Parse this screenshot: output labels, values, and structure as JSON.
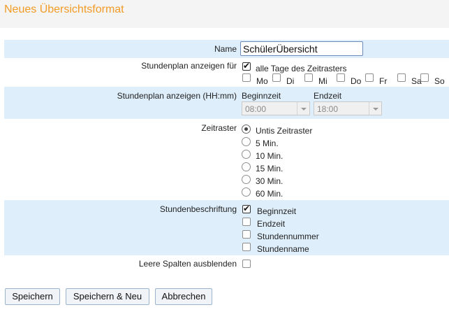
{
  "page": {
    "title": "Neues Übersichtsformat"
  },
  "form": {
    "name": {
      "label": "Name",
      "value": "SchülerÜbersicht"
    },
    "show_for": {
      "label": "Stundenplan anzeigen für",
      "all_days": {
        "label": "alle Tage des Zeitrasters",
        "checked": true
      },
      "days": [
        {
          "label": "Mo",
          "checked": false
        },
        {
          "label": "Di",
          "checked": false
        },
        {
          "label": "Mi",
          "checked": false
        },
        {
          "label": "Do",
          "checked": false
        },
        {
          "label": "Fr",
          "checked": false
        },
        {
          "label": "Sa",
          "checked": false
        },
        {
          "label": "So",
          "checked": false
        }
      ]
    },
    "show_time": {
      "label": "Stundenplan anzeigen (HH:mm)",
      "begin_label": "Beginnzeit",
      "begin_value": "08:00",
      "end_label": "Endzeit",
      "end_value": "18:00"
    },
    "raster": {
      "label": "Zeitraster",
      "options": [
        {
          "label": "Untis Zeitraster",
          "selected": true
        },
        {
          "label": "5 Min.",
          "selected": false
        },
        {
          "label": "10 Min.",
          "selected": false
        },
        {
          "label": "15 Min.",
          "selected": false
        },
        {
          "label": "30 Min.",
          "selected": false
        },
        {
          "label": "60 Min.",
          "selected": false
        }
      ]
    },
    "labeling": {
      "label": "Stundenbeschriftung",
      "options": [
        {
          "label": "Beginnzeit",
          "checked": true
        },
        {
          "label": "Endzeit",
          "checked": false
        },
        {
          "label": "Stundennummer",
          "checked": false
        },
        {
          "label": "Stundenname",
          "checked": false
        }
      ]
    },
    "hide_empty": {
      "label": "Leere Spalten ausblenden",
      "checked": false
    }
  },
  "buttons": {
    "save": "Speichern",
    "save_new": "Speichern & Neu",
    "cancel": "Abbrechen"
  }
}
